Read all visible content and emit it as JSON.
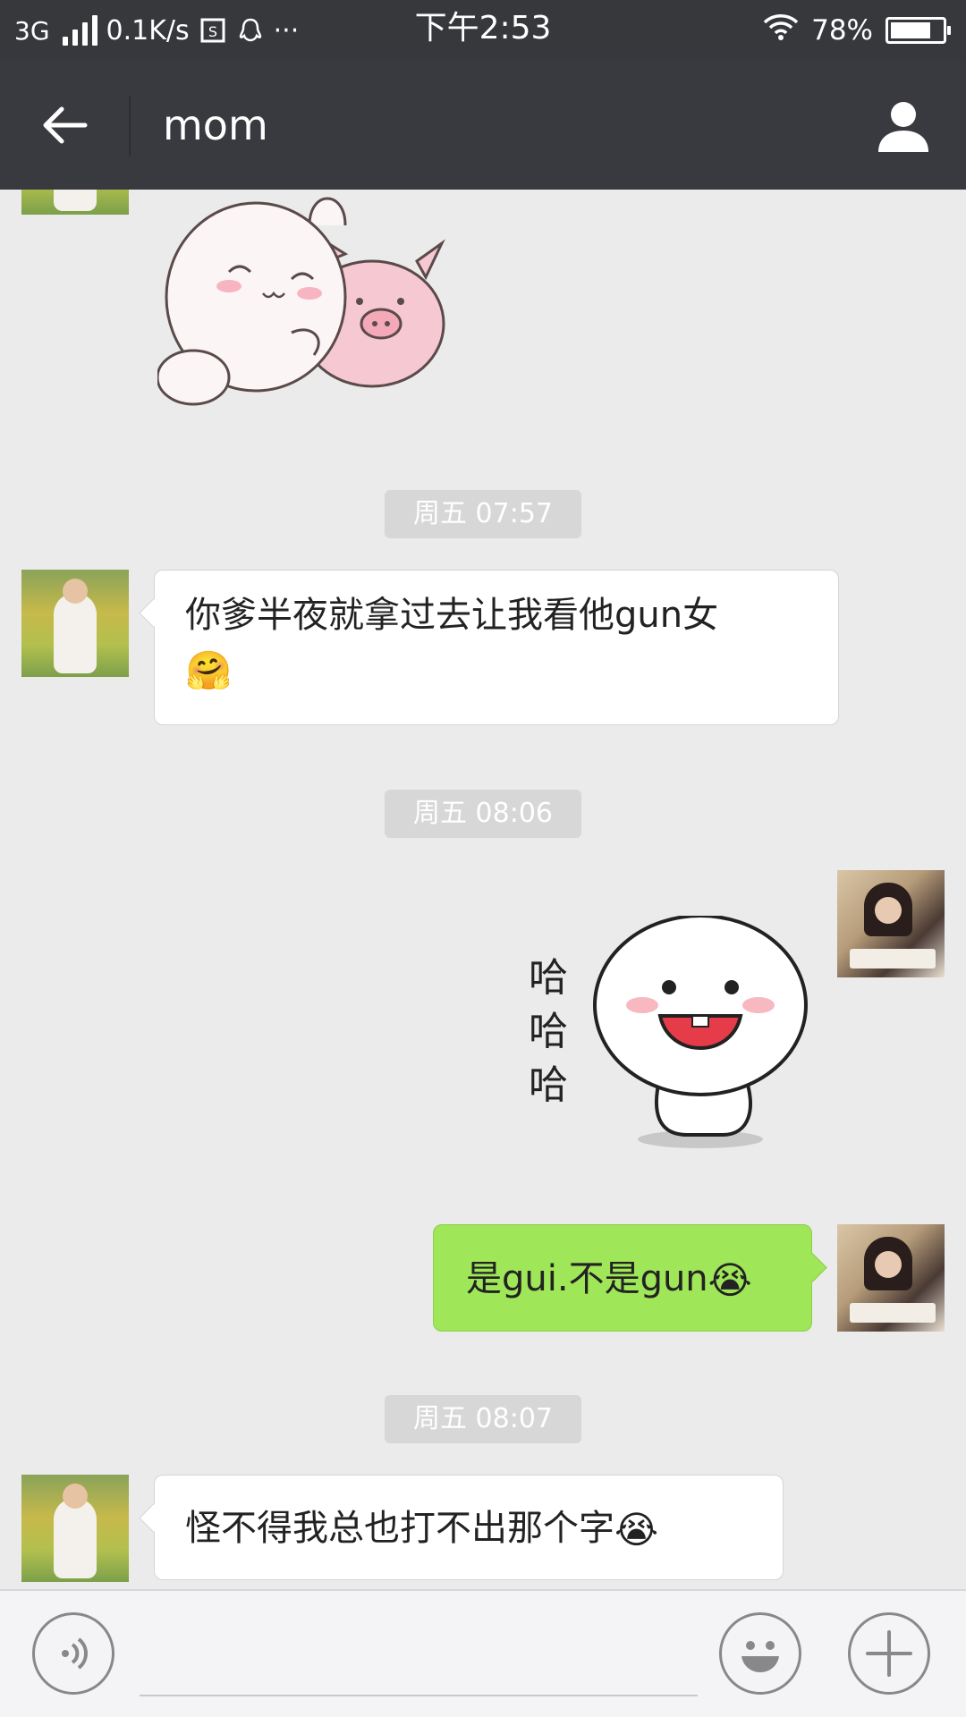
{
  "status_bar": {
    "network": "3G",
    "speed": "0.1K/s",
    "more": "···",
    "time": "下午2:53",
    "battery_percent": "78%",
    "battery_level": 0.78,
    "icons": [
      "signal-icon",
      "sim-icon",
      "qq-icon",
      "wifi-icon",
      "battery-icon"
    ]
  },
  "header": {
    "title": "mom",
    "back_icon": "back-arrow-icon",
    "profile_icon": "person-icon"
  },
  "messages": [
    {
      "type": "sticker",
      "side": "left",
      "description_icon": "bunny-pig-hug-sticker"
    },
    {
      "type": "time",
      "text": "周五 07:57"
    },
    {
      "type": "text",
      "side": "left",
      "text": "你爹半夜就拿过去让我看他gun女",
      "emoji": "🤗"
    },
    {
      "type": "time",
      "text": "周五 08:06"
    },
    {
      "type": "sticker",
      "side": "right",
      "sticker_text": [
        "哈",
        "哈",
        "哈"
      ],
      "description_icon": "laughing-bun-sticker"
    },
    {
      "type": "text",
      "side": "right",
      "text": "是gui.不是gun",
      "emoji": "😭"
    },
    {
      "type": "time",
      "text": "周五 08:07"
    },
    {
      "type": "text",
      "side": "left",
      "text": "怪不得我总也打不出那个字",
      "emoji": "😭"
    }
  ],
  "input_bar": {
    "voice_icon": "voice-icon",
    "emoji_icon": "smiley-icon",
    "plus_icon": "plus-icon",
    "placeholder": ""
  },
  "colors": {
    "status_bar": "#37383c",
    "title_bar": "#393a3f",
    "chat_bg": "#ebebeb",
    "sent_bubble": "#9fe658",
    "received_bubble": "#ffffff",
    "time_pill": "#d7d7d7"
  }
}
